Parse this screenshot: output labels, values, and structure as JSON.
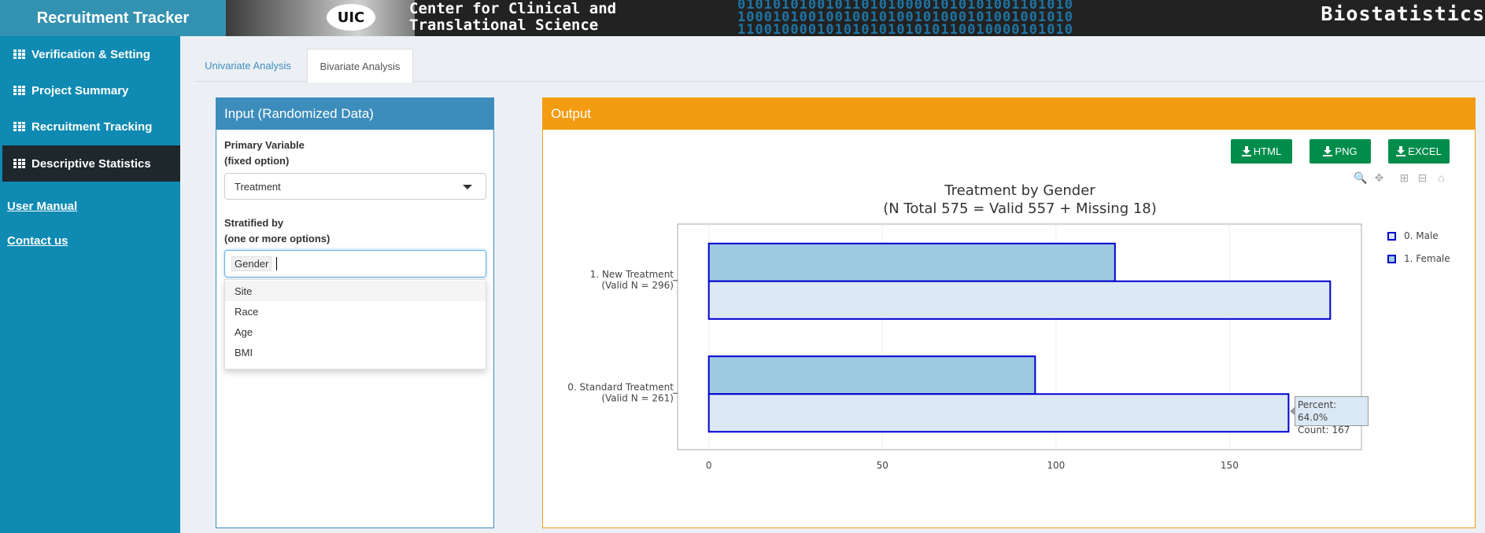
{
  "app": {
    "title": "Recruitment Tracker"
  },
  "banner": {
    "logo_text": "UIC",
    "center_line1": "Center for Clinical and",
    "center_line2": "Translational Science",
    "right_text": "Biostatistics"
  },
  "sidebar": {
    "items": [
      {
        "label": "Verification & Setting",
        "icon": "table-icon",
        "active": false
      },
      {
        "label": "Project Summary",
        "icon": "table-icon",
        "active": false
      },
      {
        "label": "Recruitment Tracking",
        "icon": "table-icon",
        "active": false
      },
      {
        "label": "Descriptive Statistics",
        "icon": "table-icon",
        "active": true
      }
    ],
    "links": [
      {
        "label": "User Manual"
      },
      {
        "label": "Contact us"
      }
    ]
  },
  "tabs": [
    {
      "label": "Univariate Analysis",
      "active": false
    },
    {
      "label": "Bivariate Analysis",
      "active": true
    }
  ],
  "input_panel": {
    "title": "Input (Randomized Data)",
    "primary_label_1": "Primary Variable",
    "primary_label_2": "(fixed option)",
    "primary_value": "Treatment",
    "strat_label_1": "Stratified by",
    "strat_label_2": "(one or more options)",
    "strat_selected": "Gender",
    "dropdown_options": [
      "Site",
      "Race",
      "Age",
      "BMI"
    ]
  },
  "output_panel": {
    "title": "Output",
    "buttons": [
      {
        "label": "HTML"
      },
      {
        "label": "PNG"
      },
      {
        "label": "EXCEL"
      }
    ],
    "modebar": [
      "zoom-icon",
      "pan-icon",
      "zoom-in-icon",
      "zoom-out-icon",
      "reset-home-icon"
    ]
  },
  "chart_data": {
    "type": "bar",
    "orientation": "horizontal",
    "title": "Treatment by Gender",
    "subtitle": "(N Total 575 = Valid 557 + Missing 18)",
    "categories": [
      {
        "line1": "0. Standard Treatment",
        "line2": "(Valid N = 261)"
      },
      {
        "line1": "1. New Treatment",
        "line2": "(Valid N = 296)"
      }
    ],
    "series": [
      {
        "name": "0. Male",
        "values": [
          167,
          179
        ],
        "color": "#dde8f5"
      },
      {
        "name": "1. Female",
        "values": [
          94,
          117
        ],
        "color": "#9ecae1"
      }
    ],
    "bar_outline_color": "#0000cd",
    "x_ticks": [
      "0",
      "50",
      "100",
      "150"
    ],
    "xlim": [
      -9,
      188
    ],
    "grid": true,
    "legend_position": "right",
    "tooltip": {
      "line1": "Percent: 64.0%",
      "line2": "Count: 167"
    }
  }
}
